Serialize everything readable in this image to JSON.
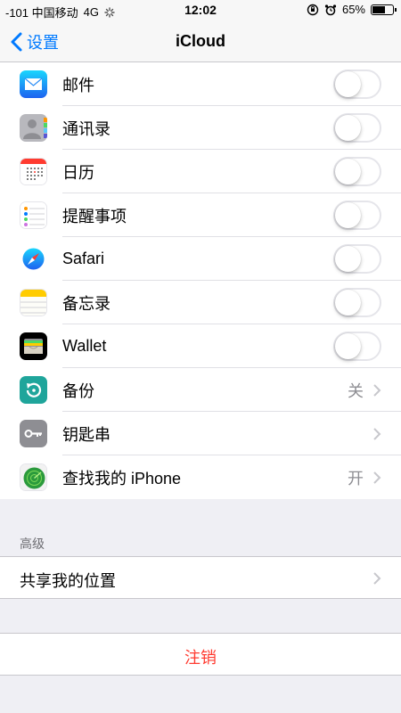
{
  "status_bar": {
    "carrier": "-101 中国移动",
    "network": "4G",
    "time": "12:02",
    "battery": "65%",
    "battery_level": 0.65
  },
  "nav": {
    "back_label": "设置",
    "title": "iCloud"
  },
  "items": [
    {
      "label": "邮件",
      "icon": "mail-icon",
      "control": "switch",
      "on": false
    },
    {
      "label": "通讯录",
      "icon": "contacts-icon",
      "control": "switch",
      "on": false
    },
    {
      "label": "日历",
      "icon": "calendar-icon",
      "control": "switch",
      "on": false
    },
    {
      "label": "提醒事项",
      "icon": "reminders-icon",
      "control": "switch",
      "on": false
    },
    {
      "label": "Safari",
      "icon": "safari-icon",
      "control": "switch",
      "on": false
    },
    {
      "label": "备忘录",
      "icon": "notes-icon",
      "control": "switch",
      "on": false
    },
    {
      "label": "Wallet",
      "icon": "wallet-icon",
      "control": "switch",
      "on": false
    },
    {
      "label": "备份",
      "icon": "backup-icon",
      "control": "chevron",
      "value": "关"
    },
    {
      "label": "钥匙串",
      "icon": "keychain-icon",
      "control": "chevron",
      "value": ""
    },
    {
      "label": "查找我的 iPhone",
      "icon": "find-my-iphone-icon",
      "control": "chevron",
      "value": "开"
    }
  ],
  "advanced": {
    "header": "高级",
    "share_location_label": "共享我的位置"
  },
  "logout_label": "注销",
  "colors": {
    "accent": "#007aff",
    "destructive": "#ff3b30",
    "background": "#efeff4"
  }
}
